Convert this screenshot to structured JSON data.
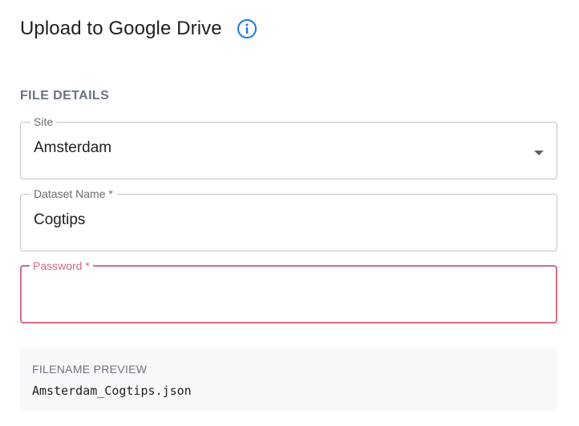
{
  "header": {
    "title": "Upload to Google Drive",
    "info_icon": "info-circle-icon"
  },
  "section": {
    "label": "FILE DETAILS"
  },
  "fields": {
    "site": {
      "label": "Site",
      "value": "Amsterdam",
      "icon": "caret-down-icon"
    },
    "dataset_name": {
      "label": "Dataset Name *",
      "value": "Cogtips"
    },
    "password": {
      "label": "Password *",
      "value": "",
      "state": "error"
    }
  },
  "preview": {
    "label": "FILENAME PREVIEW",
    "value": "Amsterdam_Cogtips.json"
  },
  "colors": {
    "accent": "#1a73e8",
    "error": "#d16b84",
    "border": "#c4c4c4",
    "muted_text": "#6b7280",
    "preview_bg": "#f7f8fa"
  }
}
